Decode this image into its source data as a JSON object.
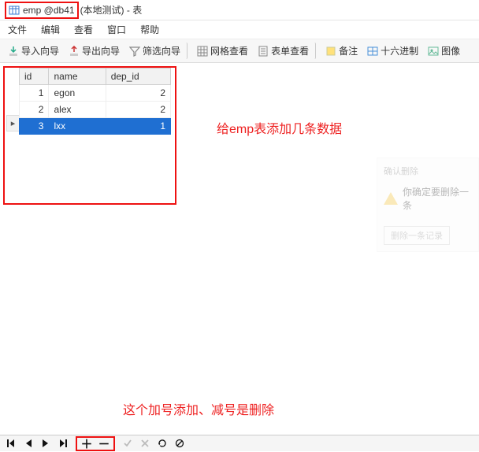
{
  "title": {
    "highlight_pre": "emp @",
    "highlight_db": "db41",
    "rest": " (本地测试) - 表"
  },
  "menubar": {
    "file": "文件",
    "edit": "编辑",
    "view": "查看",
    "window": "窗口",
    "help": "帮助"
  },
  "toolbar": {
    "import": "导入向导",
    "export": "导出向导",
    "filter": "筛选向导",
    "grid": "网格查看",
    "form": "表单查看",
    "note": "备注",
    "hex": "十六进制",
    "image": "图像"
  },
  "table": {
    "headers": {
      "id": "id",
      "name": "name",
      "dep_id": "dep_id"
    },
    "rows": [
      {
        "id": "1",
        "name": "egon",
        "dep_id": "2",
        "selected": false
      },
      {
        "id": "2",
        "name": "alex",
        "dep_id": "2",
        "selected": false
      },
      {
        "id": "3",
        "name": "lxx",
        "dep_id": "1",
        "selected": true
      }
    ],
    "row_marker": "▸"
  },
  "annotations": {
    "a1": "给emp表添加几条数据",
    "a2": "这个加号添加、减号是删除"
  },
  "dialog": {
    "title": "确认删除",
    "msg": "你确定要删除一条",
    "btn": "删除一条记录"
  },
  "navbar": {
    "plus": "＋",
    "minus": "－"
  }
}
